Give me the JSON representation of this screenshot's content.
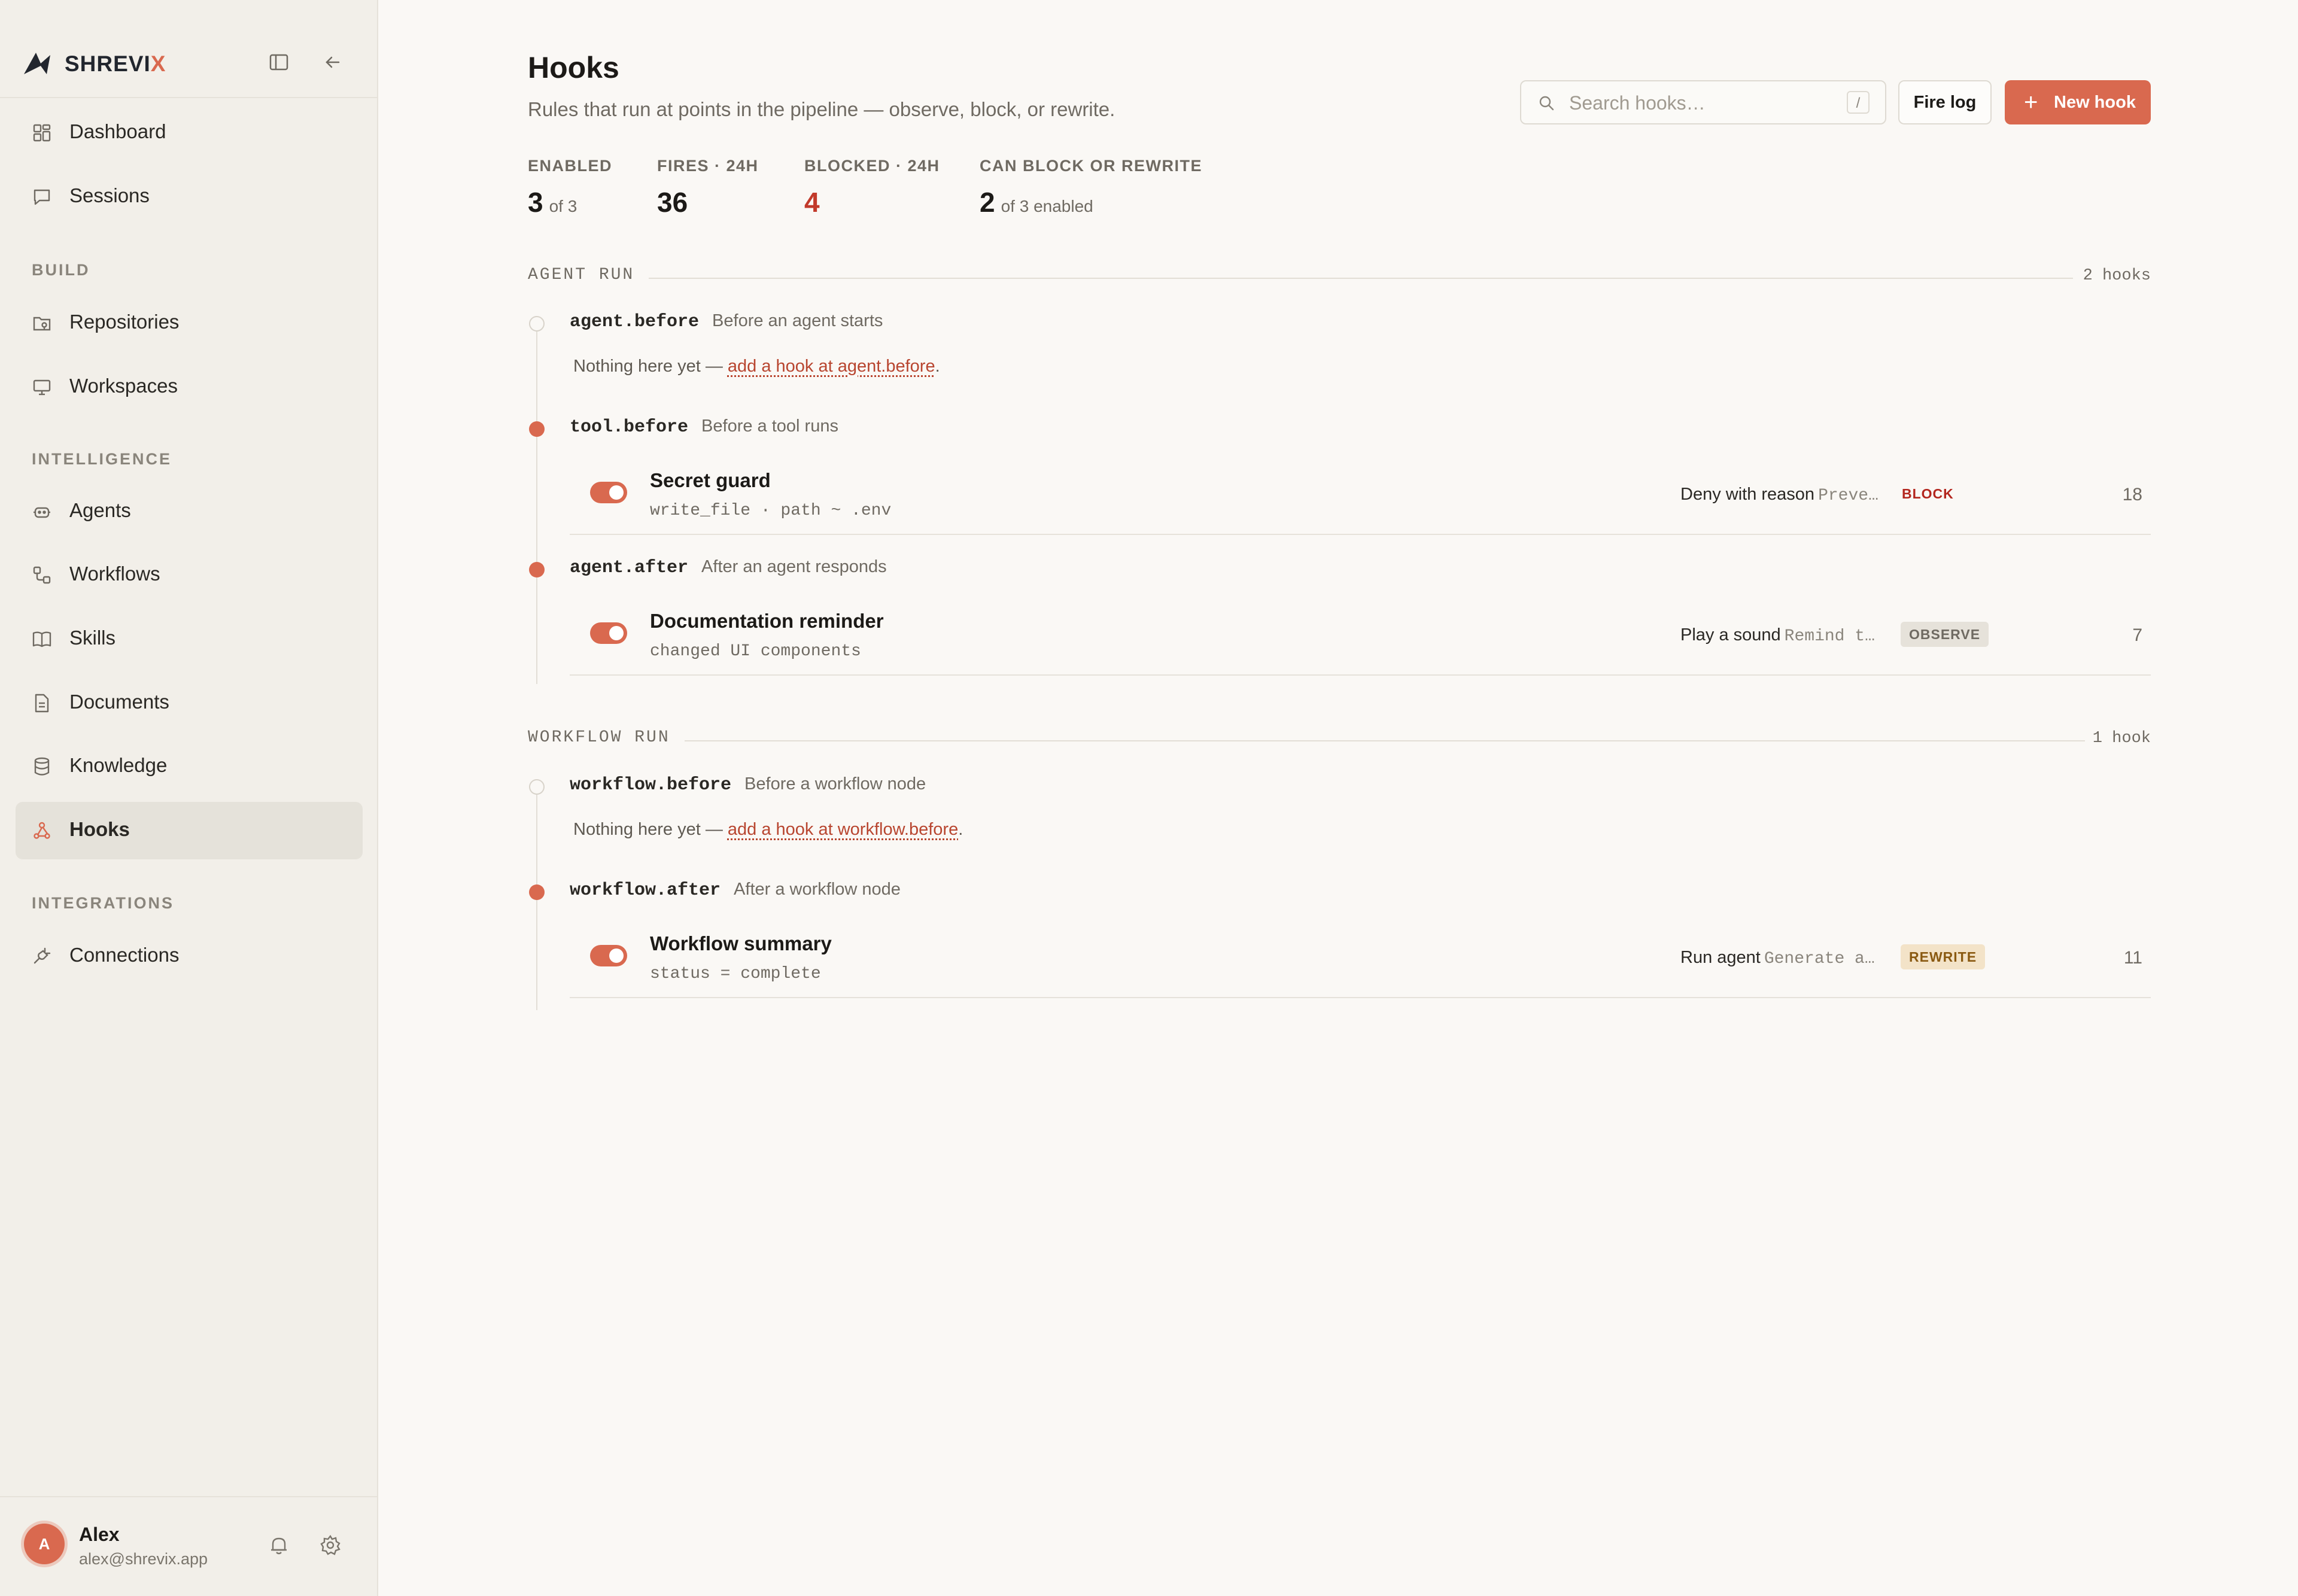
{
  "brand": {
    "name_main": "SHREVI",
    "name_accent": "X",
    "accent_color": "#d9694f"
  },
  "sidebar": {
    "top_items": [
      {
        "label": "Dashboard",
        "icon": "dashboard-icon"
      },
      {
        "label": "Sessions",
        "icon": "chat-bubble-icon"
      }
    ],
    "sections": [
      {
        "title": "BUILD",
        "items": [
          {
            "label": "Repositories",
            "icon": "repository-icon"
          },
          {
            "label": "Workspaces",
            "icon": "monitor-icon"
          }
        ]
      },
      {
        "title": "INTELLIGENCE",
        "items": [
          {
            "label": "Agents",
            "icon": "robot-icon"
          },
          {
            "label": "Workflows",
            "icon": "workflow-icon"
          },
          {
            "label": "Skills",
            "icon": "book-icon"
          },
          {
            "label": "Documents",
            "icon": "document-icon"
          },
          {
            "label": "Knowledge",
            "icon": "database-icon"
          },
          {
            "label": "Hooks",
            "icon": "hook-icon",
            "active": true
          }
        ]
      },
      {
        "title": "INTEGRATIONS",
        "items": [
          {
            "label": "Connections",
            "icon": "plug-icon"
          }
        ]
      }
    ],
    "user": {
      "initial": "A",
      "name": "Alex",
      "email": "alex@shrevix.app"
    }
  },
  "page": {
    "title": "Hooks",
    "subtitle": "Rules that run at points in the pipeline — observe, block, or rewrite."
  },
  "toolbar": {
    "search_placeholder": "Search hooks…",
    "search_value": "",
    "search_shortcut": "/",
    "fire_log_label": "Fire log",
    "new_hook_label": "New hook"
  },
  "stats": {
    "enabled": {
      "label": "ENABLED",
      "value": "3",
      "sub": "of 3"
    },
    "fires": {
      "label": "FIRES · 24H",
      "value": "36"
    },
    "blocked": {
      "label": "BLOCKED · 24H",
      "value": "4",
      "color": "#c23a2b"
    },
    "can_block": {
      "label": "CAN BLOCK OR REWRITE",
      "value": "2",
      "sub": "of 3 enabled"
    }
  },
  "groups": {
    "agent_run": {
      "label": "AGENT RUN",
      "count": "2 hooks",
      "events": {
        "agent_before": {
          "name": "agent.before",
          "desc": "Before an agent starts",
          "empty_prefix": "Nothing here yet — ",
          "empty_link": "add a hook at agent.before",
          "empty_suffix": "."
        },
        "tool_before": {
          "name": "tool.before",
          "desc": "Before a tool runs",
          "hook": {
            "name": "Secret guard",
            "condition": "write_file · path ~ .env",
            "action": "Deny with reason",
            "action_arg": "Preve…",
            "mode": "BLOCK",
            "count": "18",
            "enabled": true
          }
        },
        "agent_after": {
          "name": "agent.after",
          "desc": "After an agent responds",
          "hook": {
            "name": "Documentation reminder",
            "condition": "changed UI components",
            "action": "Play a sound",
            "action_arg": "Remind t…",
            "mode": "OBSERVE",
            "count": "7",
            "enabled": true
          }
        }
      }
    },
    "workflow_run": {
      "label": "WORKFLOW RUN",
      "count": "1 hook",
      "events": {
        "workflow_before": {
          "name": "workflow.before",
          "desc": "Before a workflow node",
          "empty_prefix": "Nothing here yet — ",
          "empty_link": "add a hook at workflow.before",
          "empty_suffix": "."
        },
        "workflow_after": {
          "name": "workflow.after",
          "desc": "After a workflow node",
          "hook": {
            "name": "Workflow summary",
            "condition": "status = complete",
            "action": "Run agent",
            "action_arg": "Generate a…",
            "mode": "REWRITE",
            "count": "11",
            "enabled": true
          }
        }
      }
    }
  }
}
